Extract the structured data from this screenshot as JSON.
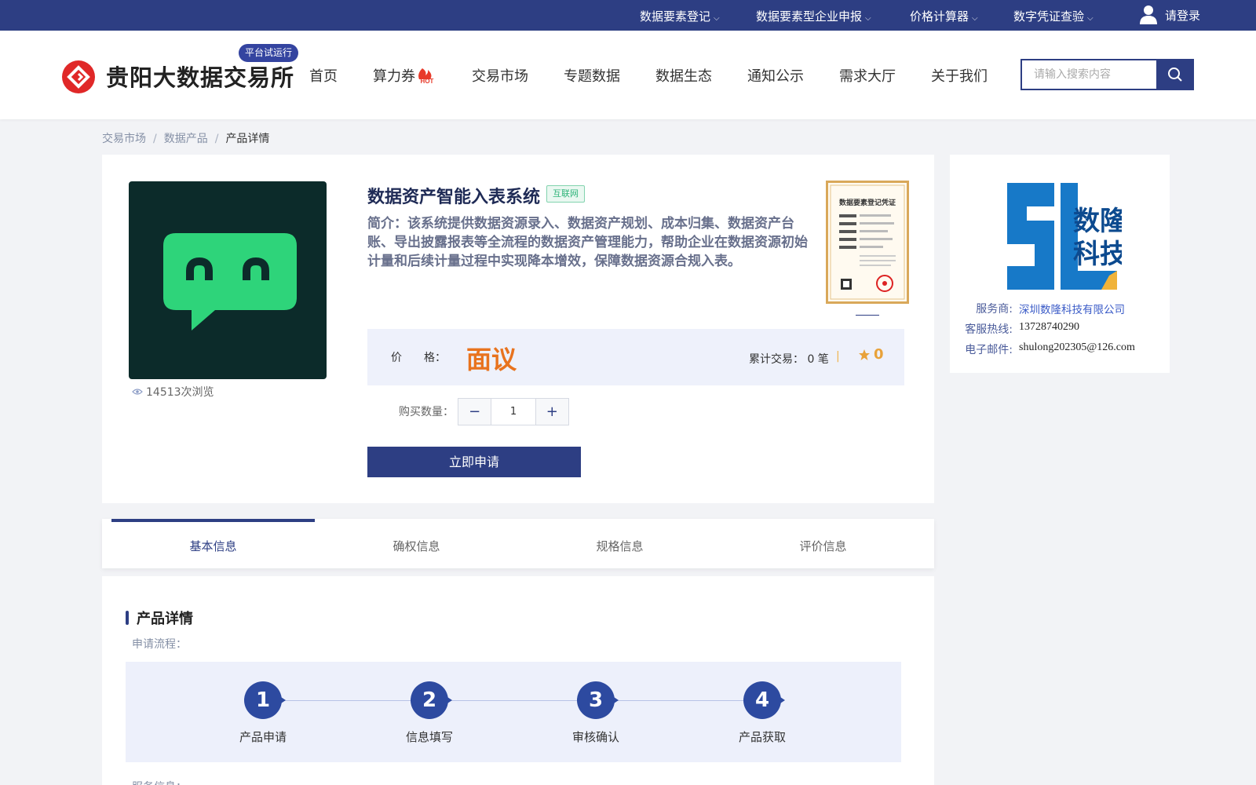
{
  "topnav": {
    "items": [
      {
        "label": "数据要素登记"
      },
      {
        "label": "数据要素型企业申报"
      },
      {
        "label": "价格计算器"
      },
      {
        "label": "数字凭证查验"
      }
    ],
    "login_label": "请登录"
  },
  "header": {
    "site_name": "贵阳大数据交易所",
    "trial_badge": "平台试运行",
    "nav": [
      "首页",
      "算力券",
      "交易市场",
      "专题数据",
      "数据生态",
      "通知公示",
      "需求大厅",
      "关于我们"
    ],
    "hot_badge": "HOT",
    "search_placeholder": "请输入搜索内容"
  },
  "breadcrumb": [
    "交易市场",
    "数据产品",
    "产品详情"
  ],
  "breadcrumb_sep": "/",
  "product": {
    "title": "数据资产智能入表系统",
    "tag": "互联网",
    "intro": "简介：该系统提供数据资源录入、数据资产规划、成本归集、数据资产台账、导出披露报表等全流程的数据资产管理能力，帮助企业在数据资源初始计量和后续计量过程中实现降本增效，保障数据资源合规入表。",
    "views": "14513次浏览",
    "price_label": "价　　格：",
    "price_value": "面议",
    "trade_label": "累计交易：",
    "trade_value": "0 笔",
    "rating": "0",
    "qty_label": "购买数量：",
    "qty_value": "1",
    "apply_label": "立即申请",
    "cert_title": "数据要素登记凭证",
    "accent_color": "#2d3e83",
    "price_color": "#e8731e"
  },
  "provider": {
    "logo_text_1": "数隆",
    "logo_text_2": "科技",
    "rows": [
      {
        "k": "服务商:",
        "v": "深圳数隆科技有限公司"
      },
      {
        "k": "客服热线:",
        "v": "13728740290"
      },
      {
        "k": "电子邮件:",
        "v": "shulong202305@126.com"
      }
    ]
  },
  "tabs": [
    "基本信息",
    "确权信息",
    "规格信息",
    "评价信息"
  ],
  "detail": {
    "section_title": "产品详情",
    "flow_label": "申请流程：",
    "steps": [
      {
        "num": "1",
        "label": "产品申请"
      },
      {
        "num": "2",
        "label": "信息填写"
      },
      {
        "num": "3",
        "label": "审核确认"
      },
      {
        "num": "4",
        "label": "产品获取"
      }
    ],
    "service_label": "服务信息："
  }
}
